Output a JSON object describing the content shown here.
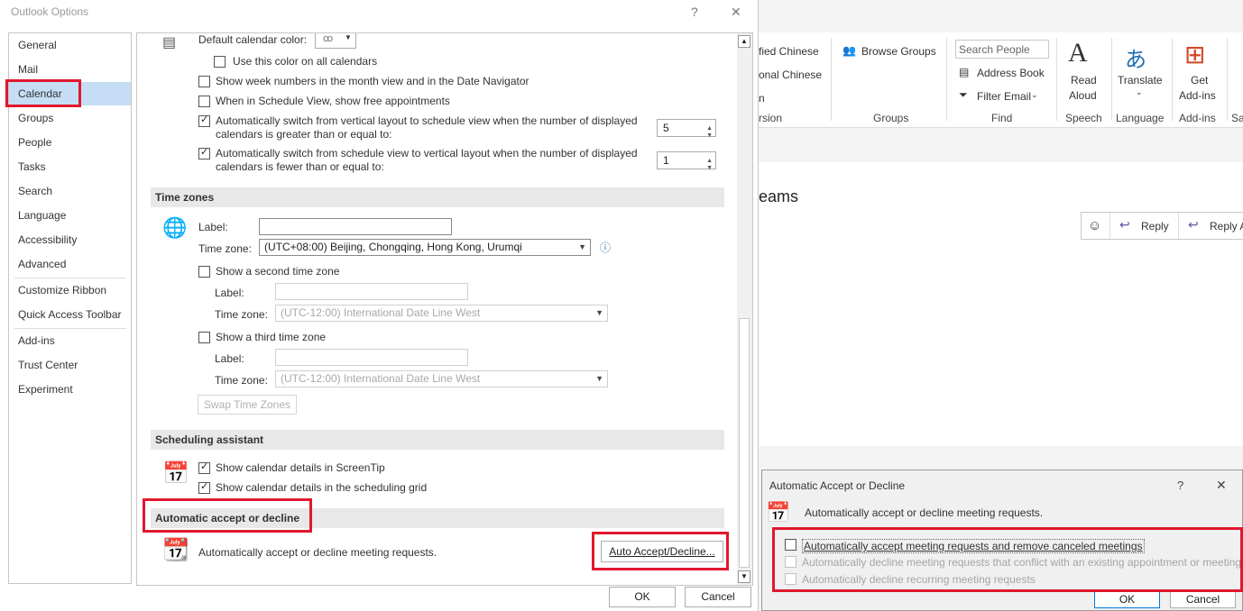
{
  "options": {
    "title": "Outlook Options",
    "help": "?",
    "close": "✕",
    "nav": [
      "General",
      "Mail",
      "Calendar",
      "Groups",
      "People",
      "Tasks",
      "Search",
      "Language",
      "Accessibility",
      "Advanced",
      "Customize Ribbon",
      "Quick Access Toolbar",
      "Add-ins",
      "Trust Center",
      "Experiment"
    ],
    "calendar_options": {
      "default_color_label": "Default calendar color:",
      "use_color_all": "Use this color on all calendars",
      "show_week_numbers": "Show week numbers in the month view and in the Date Navigator",
      "schedule_free": "When in Schedule View, show free appointments",
      "auto_switch_1a": "Automatically switch from vertical layout to schedule view when the number of displayed",
      "auto_switch_1b": "calendars is greater than or equal to:",
      "auto_switch_1_value": "5",
      "auto_switch_2a": "Automatically switch from schedule view to vertical layout when the number of displayed",
      "auto_switch_2b": "calendars is fewer than or equal to:",
      "auto_switch_2_value": "1"
    },
    "time_zones": {
      "header": "Time zones",
      "label": "Label:",
      "time_zone": "Time zone:",
      "tz_value": "(UTC+08:00) Beijing, Chongqing, Hong Kong, Urumqi",
      "second": "Show a second time zone",
      "third": "Show a third time zone",
      "tz_default": "(UTC-12:00) International Date Line West",
      "swap": "Swap Time Zones"
    },
    "scheduling": {
      "header": "Scheduling assistant",
      "screentip": "Show calendar details in ScreenTip",
      "grid": "Show calendar details in the scheduling grid"
    },
    "auto_accept": {
      "header": "Automatic accept or decline",
      "desc": "Automatically accept or decline meeting requests.",
      "button": "Auto Accept/Decline..."
    },
    "ok": "OK",
    "cancel": "Cancel"
  },
  "ribbon": {
    "lang1": "fied Chinese",
    "lang2": "onal Chinese",
    "lang3": "n",
    "version": "rsion",
    "browse_groups": "Browse Groups",
    "groups": "Groups",
    "search_people": "Search People",
    "address_book": "Address Book",
    "filter_email": "Filter Email",
    "find": "Find",
    "read": "Read",
    "aloud": "Aloud",
    "speech": "Speech",
    "translate": "Translate",
    "language": "Language",
    "get": "Get",
    "addins": "Add-ins",
    "addins_group": "Add-ins",
    "sal": "Sal"
  },
  "mail": {
    "subject": "eams",
    "reply": "Reply",
    "reply_all": "Reply A"
  },
  "auto_dialog": {
    "title": "Automatic Accept or Decline",
    "help": "?",
    "close": "✕",
    "header": "Automatically accept or decline meeting requests.",
    "opt1": "Automatically accept meeting requests and remove canceled meetings",
    "opt2": "Automatically decline meeting requests that conflict with an existing appointment or meeting",
    "opt3": "Automatically decline recurring meeting requests",
    "ok": "OK",
    "cancel": "Cancel"
  },
  "colors": {
    "highlight": "#e0182d",
    "selected": "#c5def5",
    "accent": "#1f6fb5"
  }
}
